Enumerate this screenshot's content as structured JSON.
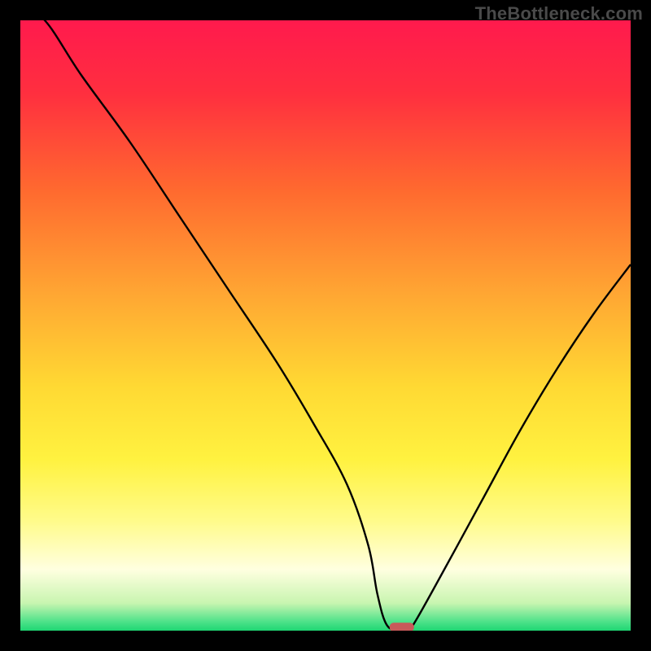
{
  "watermark": "TheBottleneck.com",
  "colors": {
    "background": "#000000",
    "curve": "#000000",
    "marker": "#c95a5a",
    "gradient_stops": [
      {
        "offset": 0.0,
        "color": "#ff1a4d"
      },
      {
        "offset": 0.12,
        "color": "#ff2f3f"
      },
      {
        "offset": 0.28,
        "color": "#ff6a2f"
      },
      {
        "offset": 0.45,
        "color": "#ffa733"
      },
      {
        "offset": 0.6,
        "color": "#ffd933"
      },
      {
        "offset": 0.72,
        "color": "#fff240"
      },
      {
        "offset": 0.82,
        "color": "#fffb8a"
      },
      {
        "offset": 0.9,
        "color": "#ffffe0"
      },
      {
        "offset": 0.955,
        "color": "#c8f5b0"
      },
      {
        "offset": 0.985,
        "color": "#4fe28a"
      },
      {
        "offset": 1.0,
        "color": "#1fd673"
      }
    ]
  },
  "chart_data": {
    "type": "line",
    "title": "",
    "xlabel": "",
    "ylabel": "",
    "xlim": [
      0,
      100
    ],
    "ylim": [
      0,
      100
    ],
    "grid": false,
    "legend": false,
    "x": [
      0,
      4,
      10,
      18,
      26,
      34,
      42,
      48,
      53.5,
      57,
      58.5,
      60,
      62,
      63.5,
      65,
      70,
      76,
      82,
      88,
      94,
      100
    ],
    "values": [
      102,
      100,
      91,
      80,
      68,
      56,
      44,
      34,
      24,
      14,
      6,
      1,
      0,
      0,
      2,
      11,
      22,
      33,
      43,
      52,
      60
    ],
    "marker": {
      "x_start": 60.5,
      "x_end": 64.5,
      "y": 0.5
    }
  }
}
